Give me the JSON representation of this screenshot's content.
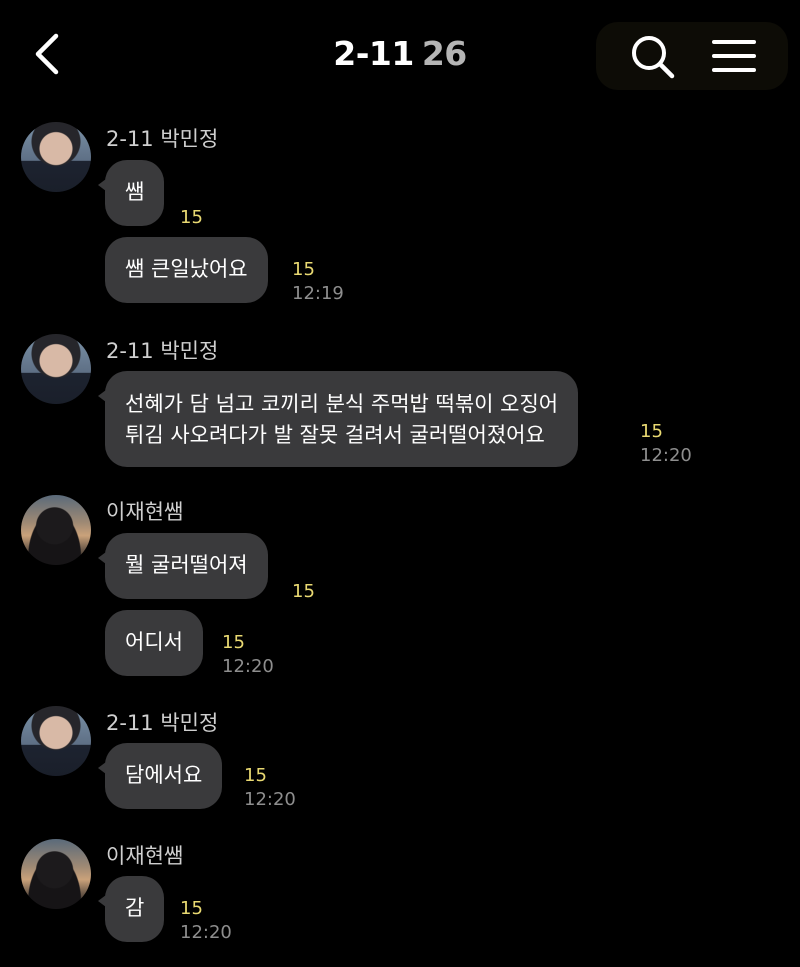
{
  "header": {
    "title": "2-11",
    "member_count": "26",
    "back_icon": "chevron-left-icon",
    "search_icon": "search-icon",
    "menu_icon": "hamburger-menu-icon"
  },
  "colors": {
    "background": "#000000",
    "bubble": "#3a3a3c",
    "unread": "#e9d972",
    "time": "#8e8e8e"
  },
  "messages": [
    {
      "sender": "2-11 박민정",
      "bubbles": [
        {
          "text": "쌤",
          "unread": "15",
          "time": ""
        },
        {
          "text": "쌤 큰일났어요",
          "unread": "15",
          "time": "12:19"
        }
      ]
    },
    {
      "sender": "2-11 박민정",
      "bubbles": [
        {
          "line1": "선혜가 담 넘고 코끼리 분식 주먹밥 떡볶이 오징어",
          "line2": "튀김 사오려다가 발 잘못 걸려서 굴러떨어졌어요",
          "unread": "15",
          "time": "12:20"
        }
      ]
    },
    {
      "sender": "이재현쌤",
      "bubbles": [
        {
          "text": "뭘 굴러떨어져",
          "unread": "15",
          "time": ""
        },
        {
          "text": "어디서",
          "unread": "15",
          "time": "12:20"
        }
      ]
    },
    {
      "sender": "2-11 박민정",
      "bubbles": [
        {
          "text": "담에서요",
          "unread": "15",
          "time": "12:20"
        }
      ]
    },
    {
      "sender": "이재현쌤",
      "bubbles": [
        {
          "text": "감",
          "unread": "15",
          "time": "12:20"
        }
      ]
    }
  ]
}
